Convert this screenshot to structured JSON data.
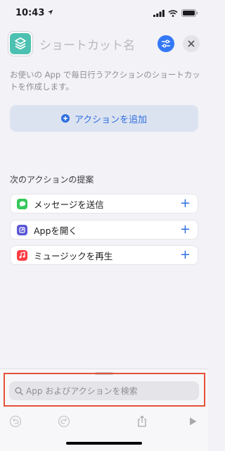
{
  "status_bar": {
    "time": "10:43"
  },
  "header": {
    "name_placeholder": "ショートカット名"
  },
  "description": "お使いの App で毎日行うアクションのショートカットを作成します。",
  "add_action": {
    "label": "アクションを追加"
  },
  "suggestions": {
    "title": "次のアクションの提案",
    "items": [
      {
        "label": "メッセージを送信",
        "icon": "messages-icon",
        "color": "#34c759"
      },
      {
        "label": "Appを開く",
        "icon": "app-open-icon",
        "color": "#5856d6"
      },
      {
        "label": "ミュージックを再生",
        "icon": "music-icon",
        "color": "#fc3c44"
      }
    ]
  },
  "search": {
    "placeholder": "App およびアクションを検索"
  },
  "colors": {
    "accent": "#3478f6",
    "highlight": "#e6513a",
    "app_icon": "#4dc1b1"
  }
}
